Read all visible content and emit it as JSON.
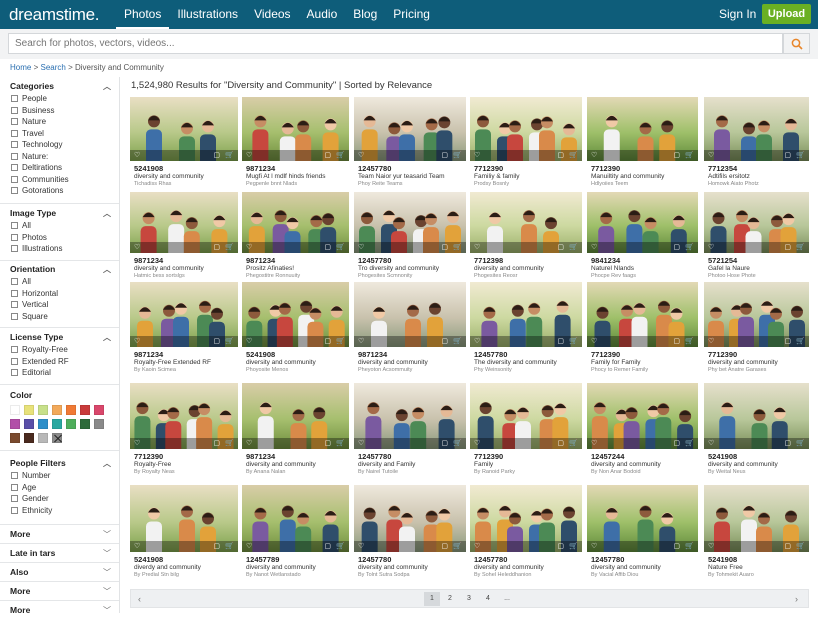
{
  "brand": {
    "logo": "dreamstime."
  },
  "nav": [
    "Photos",
    "Illustrations",
    "Videos",
    "Audio",
    "Blog",
    "Pricing"
  ],
  "header": {
    "signin": "Sign In",
    "upload": "Upload"
  },
  "search": {
    "placeholder": "Search for photos, vectors, videos..."
  },
  "breadcrumb": {
    "home": "Home",
    "sep1": ">",
    "search": "Search",
    "sep2": ">",
    "current": "Diversity and Community"
  },
  "filters": {
    "categories": {
      "title": "Categories",
      "options": [
        "People",
        "Business",
        "Nature",
        "Travel",
        "Technology",
        "Nature:",
        "Deltirations",
        "Communities",
        "Gotorations"
      ]
    },
    "image_type": {
      "title": "Image Type",
      "options": [
        "All",
        "Photos",
        "Illustrations"
      ]
    },
    "orientation": {
      "title": "Orientation",
      "options": [
        "All",
        "Horizontal",
        "Vertical",
        "Square"
      ]
    },
    "license": {
      "title": "License Type",
      "options": [
        "Royalty-Free",
        "Extended RF",
        "Editorial"
      ]
    },
    "color": {
      "title": "Color",
      "swatches": [
        "#ffffff",
        "#e8e27a",
        "#c7e08a",
        "#f2a95a",
        "#f07a35",
        "#c93b3b",
        "#d9476b",
        "#b24fa8",
        "#5a4fa8",
        "#2e8fc9",
        "#2aa8a0",
        "#4fae5c",
        "#2d6b3a",
        "#8a8a8a",
        "#7a4a2e",
        "#4a2a1e",
        "#b8b8b8",
        "X"
      ]
    },
    "people": {
      "title": "People Filters",
      "options": [
        "Number",
        "Age",
        "Gender",
        "Ethnicity"
      ]
    },
    "more": [
      "More",
      "Late in tars",
      "Also",
      "More",
      "More"
    ]
  },
  "results": {
    "summary": "1,524,980 Results for \"Diversity and Community\" | Sorted by Relevance"
  },
  "rows": [
    [
      {
        "id": "5241908",
        "title": "diversity and community",
        "author": "Tichadiss Rhas"
      },
      {
        "id": "9871234",
        "title": "Mugfi At l mdlf hinds friends",
        "author": "Pegpenle bnnt Nlads"
      },
      {
        "id": "12457780",
        "title": "Team Naior yur teasarid Team",
        "author": "Phoy Reite Teams"
      },
      {
        "id": "7712390",
        "title": "Familiy & family",
        "author": "Prodsy Bosnly"
      },
      {
        "id": "7712390",
        "title": "Manuiltity and community",
        "author": "Hdlyoiies Teem"
      },
      {
        "id": "7712354",
        "title": "Adtifils ersitotz",
        "author": "Homowk Aiato Photz"
      }
    ],
    [
      {
        "id": "9871234",
        "title": "diversity and community",
        "author": "Hatmic bess sortslgs"
      },
      {
        "id": "9871234",
        "title": "Prositz Afinaties!",
        "author": "Phegostitre Ronnuuity"
      },
      {
        "id": "12457780",
        "title": "Tro diversity and community",
        "author": "Phogesites Scmnonity"
      },
      {
        "id": "7712398",
        "title": "diversity and community",
        "author": "Phogesites Reosr"
      },
      {
        "id": "9841234",
        "title": "Naturel Nlands",
        "author": "Phocpe Rev faags"
      },
      {
        "id": "5721254",
        "title": "Gafel la Naure",
        "author": "Photoo Hose Phote"
      }
    ],
    [
      {
        "id": "9871234",
        "title": "Royalty-Free Extended RF",
        "author": "By Kaoin Scimea"
      },
      {
        "id": "5241908",
        "title": "diversity and community",
        "author": "Phoyosite Menos"
      },
      {
        "id": "9871234",
        "title": "diversity and community",
        "author": "Pheyoton Acsommuity"
      },
      {
        "id": "12457780",
        "title": "The diversity and community",
        "author": "Phy Weinsonity"
      },
      {
        "id": "7712390",
        "title": "Family for Family",
        "author": "Phocy to Remer Family"
      },
      {
        "id": "7712390",
        "title": "diversity and community",
        "author": "Phy bet Anatre Garases"
      }
    ],
    [
      {
        "id": "7712390",
        "title": "Royalty-Free",
        "author": "By Royalty Neas"
      },
      {
        "id": "9871234",
        "title": "diversity and community",
        "author": "By Anana Nalan"
      },
      {
        "id": "12457780",
        "title": "diversity and Family",
        "author": "By Nairel Tutoile"
      },
      {
        "id": "7712390",
        "title": "Family",
        "author": "By Ranoid Parky"
      },
      {
        "id": "12457244",
        "title": "diversity and community",
        "author": "By Non Anar Bodoid"
      },
      {
        "id": "5241908",
        "title": "diversity and community",
        "author": "By Weital Neus"
      }
    ],
    [
      {
        "id": "5241908",
        "title": "diverdy and community",
        "author": "By Predial Stn bilg"
      },
      {
        "id": "12457789",
        "title": "diversity and community",
        "author": "By Nanot Wetlanstado"
      },
      {
        "id": "12457780",
        "title": "diversity and community",
        "author": "By Tolnt Sutra Sodpa"
      },
      {
        "id": "12457780",
        "title": "diversity and community",
        "author": "By Sohel Heleddhanion"
      },
      {
        "id": "12457780",
        "title": "diversity and community",
        "author": "By Vacial Affib Diou"
      },
      {
        "id": "5241908",
        "title": "Nature Free",
        "author": "By Tohmekit Auaro"
      }
    ]
  ],
  "icons": {
    "favorite": "♡",
    "cart": "🛒",
    "lightbox": "▢"
  },
  "pagination": {
    "pages": [
      "1",
      "2",
      "3",
      "4",
      "..."
    ],
    "prev": "‹",
    "next": "›"
  }
}
